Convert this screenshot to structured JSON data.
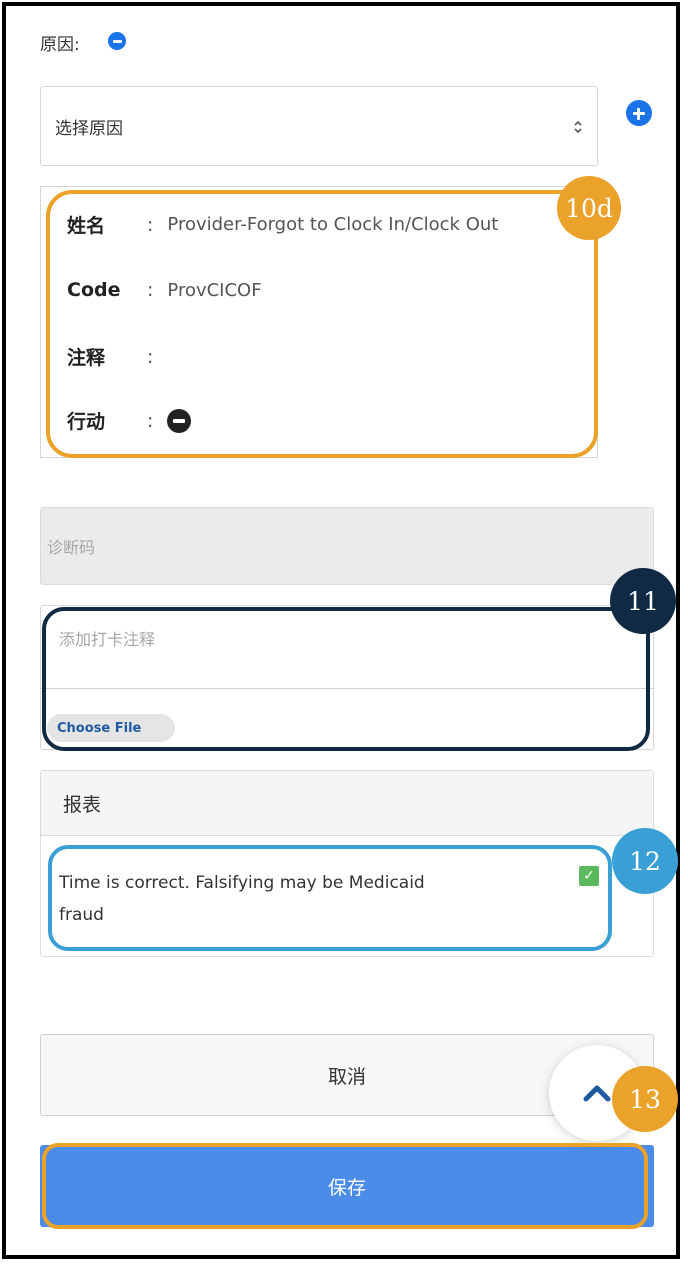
{
  "reason": {
    "label": "原因:",
    "select_placeholder": "选择原因"
  },
  "reason_detail": {
    "name_key": "姓名",
    "name_value": "Provider-Forgot to Clock In/Clock Out",
    "code_key": "Code",
    "code_value": "ProvCICOF",
    "comment_key": "注释",
    "comment_value": "",
    "action_key": "行动",
    "separator": ":"
  },
  "diagnosis": {
    "placeholder": "诊断码"
  },
  "clock_note": {
    "placeholder": "添加打卡注释",
    "choose_file": "Choose File"
  },
  "report": {
    "header": "报表",
    "attestation": "Time is correct. Falsifying may be Medicaid fraud",
    "checked": true
  },
  "buttons": {
    "cancel": "取消",
    "save": "保存"
  },
  "callouts": [
    {
      "label": "10d",
      "color": "#eaa22b"
    },
    {
      "label": "11",
      "color": "#0f2a42"
    },
    {
      "label": "12",
      "color": "#3a9fd4"
    },
    {
      "label": "13",
      "color": "#eaa22b"
    }
  ],
  "colors": {
    "accent": "#1b73e8",
    "save_button": "#4a8ce8",
    "checkbox": "#5cb85c"
  },
  "icons": {
    "remove_reason": "minus-circle-icon",
    "add_reason": "plus-circle-icon",
    "select_arrows": "sort-arrows-icon",
    "action_remove": "minus-circle-icon",
    "scroll_top": "chevron-up-icon"
  }
}
